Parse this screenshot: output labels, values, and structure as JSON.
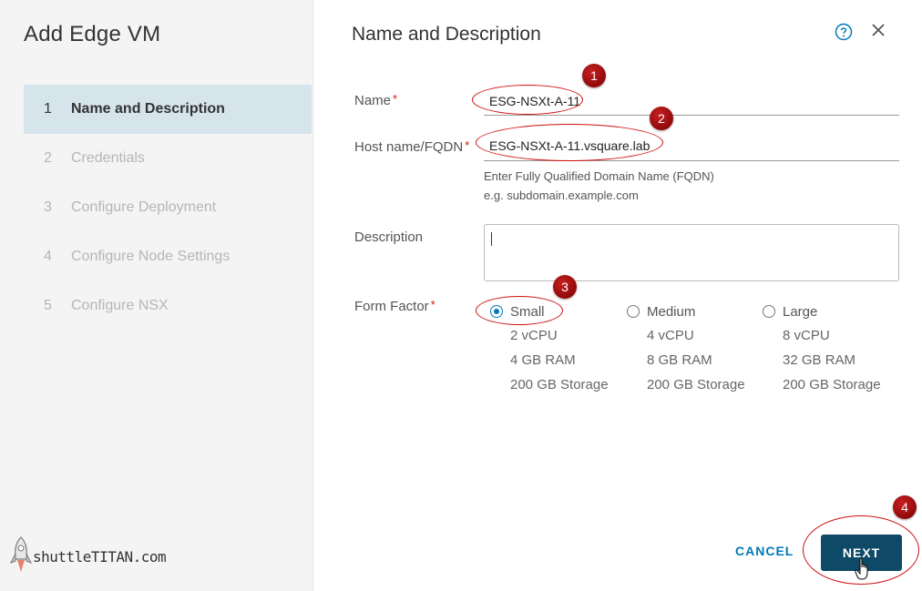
{
  "dialog": {
    "title": "Add Edge VM"
  },
  "steps": [
    {
      "num": "1",
      "label": "Name and Description"
    },
    {
      "num": "2",
      "label": "Credentials"
    },
    {
      "num": "3",
      "label": "Configure Deployment"
    },
    {
      "num": "4",
      "label": "Configure Node Settings"
    },
    {
      "num": "5",
      "label": "Configure NSX"
    }
  ],
  "main": {
    "title": "Name and Description",
    "name": {
      "label": "Name",
      "required": "*",
      "value": "ESG-NSXt-A-11"
    },
    "hostname": {
      "label": "Host name/FQDN",
      "required": "*",
      "value": "ESG-NSXt-A-11.vsquare.lab",
      "hint1": "Enter Fully Qualified Domain Name (FQDN)",
      "hint2": "e.g. subdomain.example.com"
    },
    "description": {
      "label": "Description",
      "value": ""
    },
    "form_factor": {
      "label": "Form Factor",
      "required": "*",
      "options": [
        {
          "label": "Small",
          "cpu": "2 vCPU",
          "ram": "4 GB RAM",
          "storage": "200 GB Storage",
          "selected": true
        },
        {
          "label": "Medium",
          "cpu": "4 vCPU",
          "ram": "8 GB RAM",
          "storage": "200 GB Storage",
          "selected": false
        },
        {
          "label": "Large",
          "cpu": "8 vCPU",
          "ram": "32 GB RAM",
          "storage": "200 GB Storage",
          "selected": false
        }
      ]
    }
  },
  "footer": {
    "cancel": "CANCEL",
    "next": "NEXT"
  },
  "annotations": [
    "1",
    "2",
    "3",
    "4"
  ],
  "watermark": {
    "text": "shuttleTITAN.com"
  },
  "colors": {
    "accent": "#0079b8",
    "next_button": "#0e4a68",
    "active_step": "#d6e4ec",
    "annotation": "#d01010"
  }
}
